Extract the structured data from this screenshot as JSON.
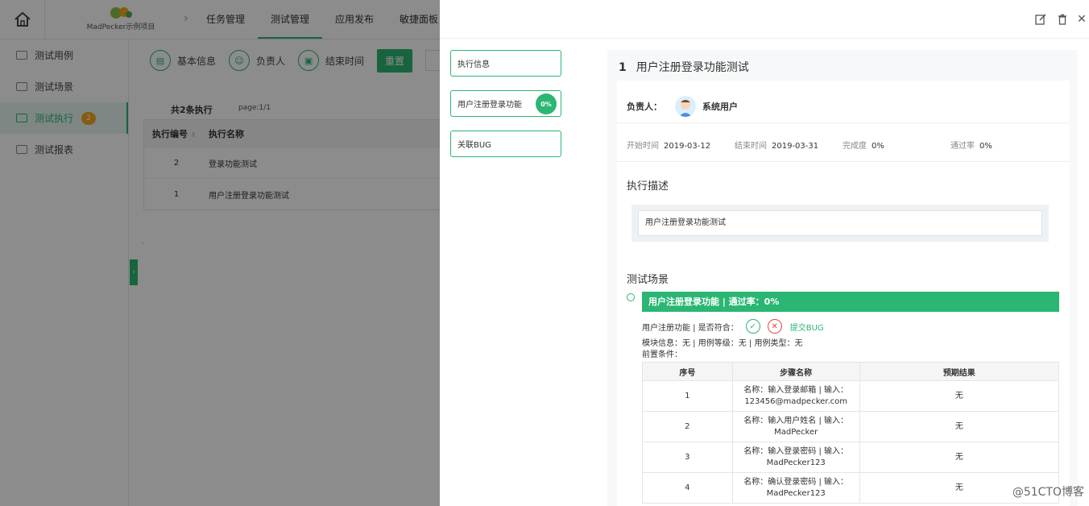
{
  "app": {
    "logo_text": "MadPecker示例项目",
    "nav": [
      "任务管理",
      "测试管理",
      "应用发布",
      "敏捷面板"
    ],
    "nav_active": 1,
    "sidebar": [
      {
        "label": "测试用例"
      },
      {
        "label": "测试场景"
      },
      {
        "label": "测试执行",
        "badge": "2"
      },
      {
        "label": "测试报表"
      }
    ],
    "filters": {
      "basic": "基本信息",
      "owner": "负责人",
      "end_time": "结束时间",
      "reset": "重置"
    },
    "list": {
      "total": "共2条执行",
      "page": "page:1/1",
      "col_id": "执行编号",
      "col_name": "执行名称",
      "rows": [
        {
          "id": "2",
          "name": "登录功能测试"
        },
        {
          "id": "1",
          "name": "用户注册登录功能测试"
        }
      ]
    }
  },
  "drawer": {
    "tabs": {
      "info": "执行信息",
      "scene": "用户注册登录功能",
      "scene_rate": "0%",
      "bug": "关联BUG"
    },
    "title_no": "1",
    "title": "用户注册登录功能测试",
    "owner_label": "负责人：",
    "owner_name": "系统用户",
    "meta": {
      "start_label": "开始时间",
      "start": "2019-03-12",
      "end_label": "结束时间",
      "end": "2019-03-31",
      "done_label": "完成度",
      "done": "0%",
      "pass_label": "通过率",
      "pass": "0%"
    },
    "desc_title": "执行描述",
    "desc": "用户注册登录功能测试",
    "scene_title": "测试场景",
    "scene_bar": "用户注册登录功能  |  通过率：0%",
    "case_label": "用户注册功能  |  是否符合：",
    "submit_bug": "提交BUG",
    "module_info": "模块信息：无  |  用例等级：无  |  用例类型：无",
    "precondition": "前置条件：",
    "steps_header": {
      "no": "序号",
      "name": "步骤名称",
      "expected": "预期结果"
    },
    "steps": [
      {
        "no": "1",
        "name_a": "名称：输入登录邮箱 | 输入：",
        "name_b": "123456@madpecker.com",
        "expected": "无"
      },
      {
        "no": "2",
        "name_a": "名称：输入用户姓名 | 输入：",
        "name_b": "MadPecker",
        "expected": "无"
      },
      {
        "no": "3",
        "name_a": "名称：输入登录密码 | 输入：",
        "name_b": "MadPecker123",
        "expected": "无"
      },
      {
        "no": "4",
        "name_a": "名称：确认登录密码 | 输入：",
        "name_b": "MadPecker123",
        "expected": "无"
      }
    ]
  },
  "watermark": "@51CTO博客",
  "colors": {
    "accent": "#2bb673",
    "badge": "#f5a623",
    "danger": "#e64545"
  }
}
